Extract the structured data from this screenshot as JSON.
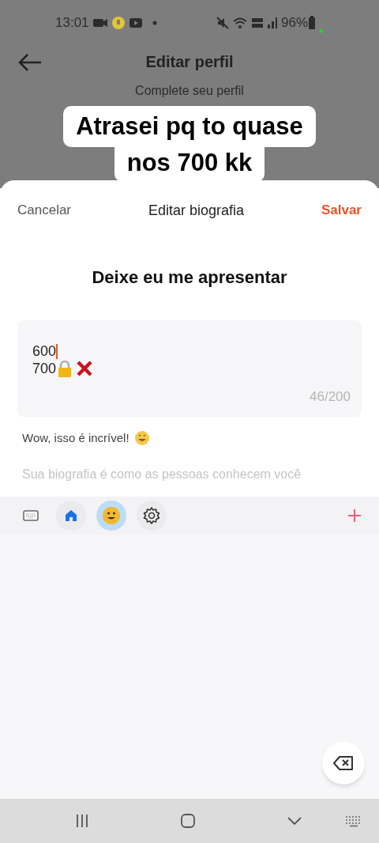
{
  "status_bar": {
    "time": "13:01",
    "battery": "96%"
  },
  "header": {
    "title": "Editar perfil",
    "subtitle": "Complete seu perfil"
  },
  "caption": [
    "Atrasei pq to quase",
    "nos 700 kk"
  ],
  "sheet": {
    "cancel": "Cancelar",
    "title": "Editar biografia",
    "save": "Salvar",
    "heading": "Deixe eu me apresentar",
    "bio_lines": [
      {
        "number": "600",
        "cursor": true
      },
      {
        "number": "700",
        "icons": [
          {
            "kind": "lock"
          },
          {
            "kind": "cross"
          }
        ]
      }
    ],
    "counter": "46/200",
    "reaction": "Wow, isso é incrível!",
    "hint": "Sua biografia é como as pessoas conhecem você"
  },
  "keyboard_tabs": [
    {
      "kind": "keyboard",
      "selected": false
    },
    {
      "kind": "home",
      "selected": false
    },
    {
      "kind": "emoji",
      "selected": true
    },
    {
      "kind": "settings",
      "selected": false
    }
  ]
}
